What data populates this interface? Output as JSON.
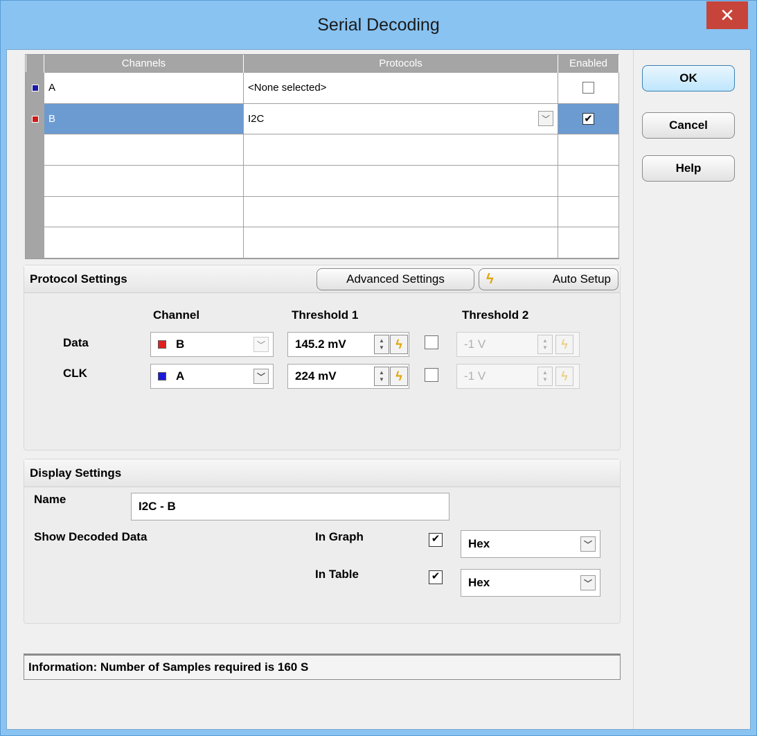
{
  "window": {
    "title": "Serial Decoding",
    "close_glyph": "✕"
  },
  "grid": {
    "headers": [
      "Channels",
      "Protocols",
      "Enabled"
    ],
    "rows": [
      {
        "channel": "A",
        "swatch": "#1a1aa8",
        "protocol": "<None selected>",
        "enabled": false
      },
      {
        "channel": "B",
        "swatch": "#d01a1a",
        "protocol": "I2C",
        "enabled": true
      }
    ]
  },
  "protocol_settings": {
    "title": "Protocol Settings",
    "advanced_label": "Advanced Settings",
    "auto_setup_label": "Auto Setup",
    "col_channel": "Channel",
    "col_threshold1": "Threshold 1",
    "col_threshold2": "Threshold 2",
    "rows": [
      {
        "label": "Data",
        "channel": "B",
        "swatch": "#e02020",
        "threshold1": "145.2 mV",
        "threshold2": "-1 V"
      },
      {
        "label": "CLK",
        "channel": "A",
        "swatch": "#1a1ad8",
        "threshold1": "224 mV",
        "threshold2": "-1 V"
      }
    ]
  },
  "display_settings": {
    "title": "Display Settings",
    "name_label": "Name",
    "name_value": "I2C - B",
    "show_decoded_label": "Show Decoded Data",
    "in_graph_label": "In Graph",
    "in_graph_format": "Hex",
    "in_table_label": "In Table",
    "in_table_format": "Hex"
  },
  "info": "Information: Number of Samples required is 160 S",
  "buttons": {
    "ok": "OK",
    "cancel": "Cancel",
    "help": "Help"
  },
  "icons": {
    "dropdown": "chevron-down-icon",
    "auto": "lightning-icon",
    "checkbox_mark": "✔"
  }
}
